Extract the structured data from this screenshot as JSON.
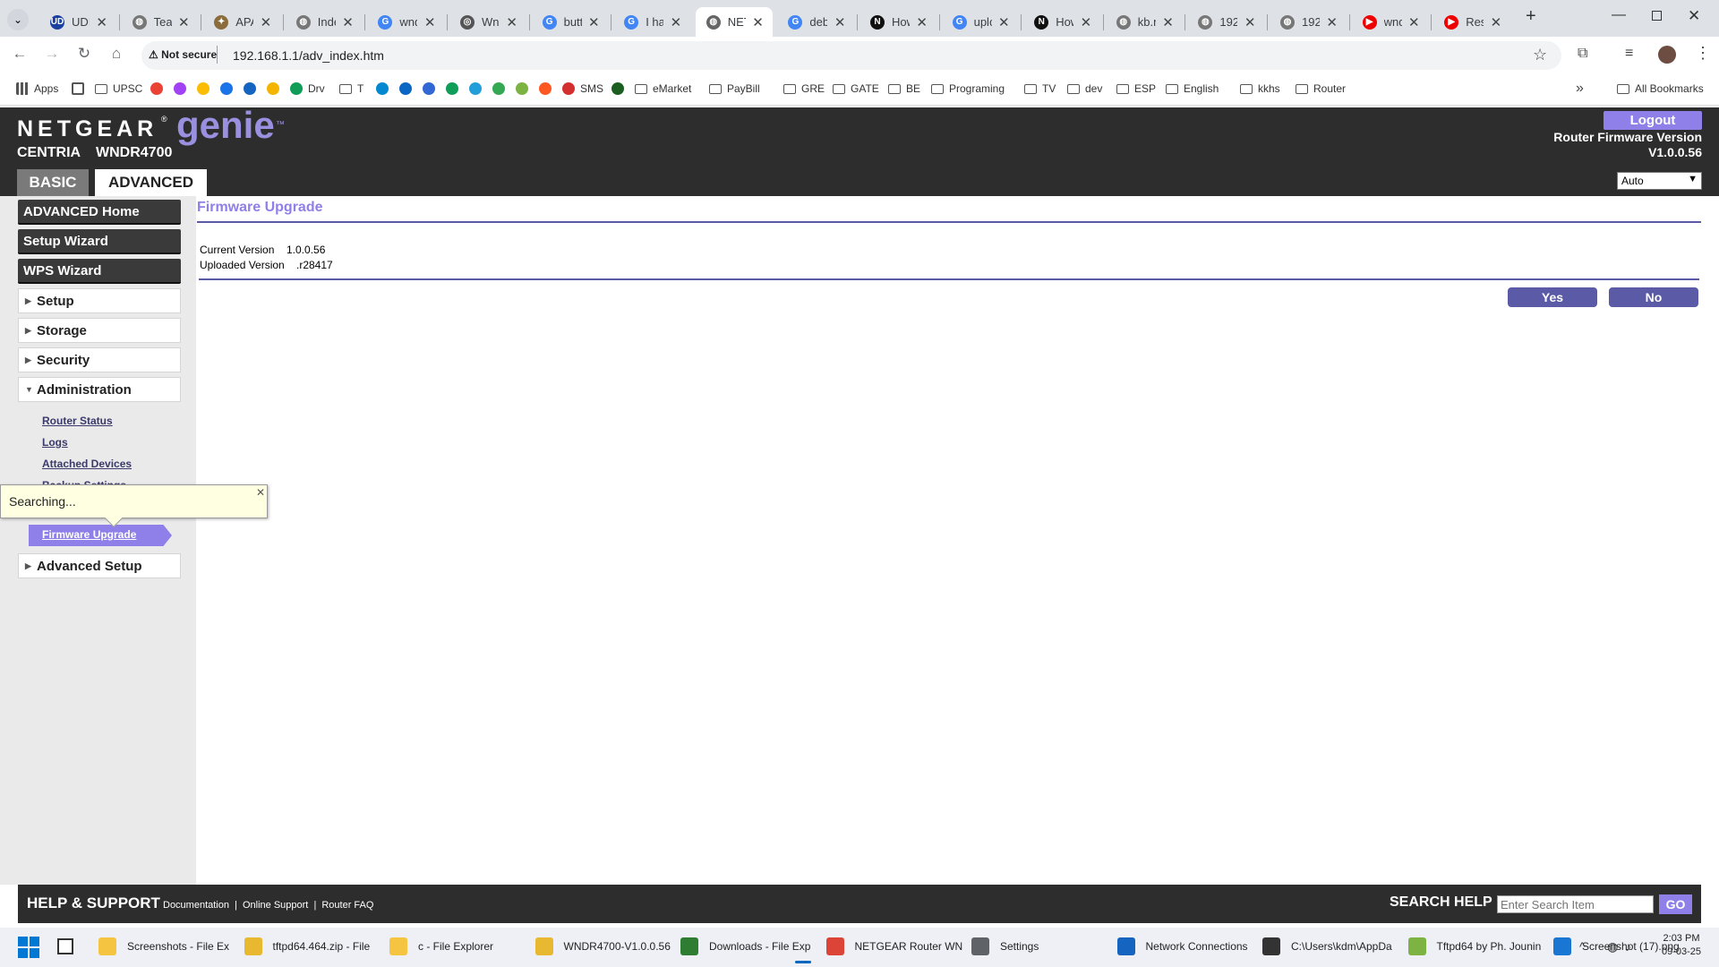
{
  "browser": {
    "tabs": [
      {
        "title": "UDI",
        "fav": "UD",
        "favbg": "#1a3fa0"
      },
      {
        "title": "Teach",
        "fav": "◍",
        "favbg": "#777"
      },
      {
        "title": "APA",
        "fav": "✦",
        "favbg": "#8a6d3b"
      },
      {
        "title": "Index",
        "fav": "◍",
        "favbg": "#777"
      },
      {
        "title": "wndr",
        "fav": "G",
        "favbg": "#4285f4"
      },
      {
        "title": "Wndr",
        "fav": "◎",
        "favbg": "#555"
      },
      {
        "title": "butt",
        "fav": "G",
        "favbg": "#4285f4"
      },
      {
        "title": "I have",
        "fav": "G",
        "favbg": "#4285f4"
      },
      {
        "title": "NETGEAR",
        "fav": "◍",
        "favbg": "#666",
        "active": true
      },
      {
        "title": "debian",
        "fav": "G",
        "favbg": "#4285f4"
      },
      {
        "title": "How",
        "fav": "N",
        "favbg": "#111"
      },
      {
        "title": "upload",
        "fav": "G",
        "favbg": "#4285f4"
      },
      {
        "title": "How",
        "fav": "N",
        "favbg": "#111"
      },
      {
        "title": "kb.net",
        "fav": "◍",
        "favbg": "#777"
      },
      {
        "title": "192",
        "fav": "◍",
        "favbg": "#777"
      },
      {
        "title": "192",
        "fav": "◍",
        "favbg": "#777"
      },
      {
        "title": "wndr",
        "fav": "▶",
        "favbg": "#e00"
      },
      {
        "title": "Reset",
        "fav": "▶",
        "favbg": "#e00"
      }
    ],
    "new_tab": "+",
    "not_secure": "Not secure",
    "url": "192.168.1.1/adv_index.htm",
    "bookmarks": [
      {
        "label": "Apps",
        "kind": "apps"
      },
      {
        "label": "",
        "kind": "grid"
      },
      {
        "label": "UPSC",
        "kind": "folder"
      },
      {
        "label": "",
        "kind": "icon",
        "color": "#ea4335"
      },
      {
        "label": "",
        "kind": "icon",
        "color": "#a142f4"
      },
      {
        "label": "",
        "kind": "icon",
        "color": "#fbbc04"
      },
      {
        "label": "",
        "kind": "icon",
        "color": "#1a73e8"
      },
      {
        "label": "",
        "kind": "icon",
        "color": "#1565c0"
      },
      {
        "label": "",
        "kind": "icon",
        "color": "#f4b400"
      },
      {
        "label": "Drv",
        "kind": "icon",
        "color": "#0f9d58"
      },
      {
        "label": "T",
        "kind": "folder"
      },
      {
        "label": "",
        "kind": "icon",
        "color": "#0288d1"
      },
      {
        "label": "",
        "kind": "icon",
        "color": "#0a66c2"
      },
      {
        "label": "",
        "kind": "icon",
        "color": "#3367d6"
      },
      {
        "label": "",
        "kind": "icon",
        "color": "#0f9d58"
      },
      {
        "label": "",
        "kind": "icon",
        "color": "#229ed9"
      },
      {
        "label": "",
        "kind": "icon",
        "color": "#34a853"
      },
      {
        "label": "",
        "kind": "icon",
        "color": "#7cb342"
      },
      {
        "label": "",
        "kind": "icon",
        "color": "#ff5722"
      },
      {
        "label": "SMS",
        "kind": "icon",
        "color": "#d32f2f"
      },
      {
        "label": "",
        "kind": "icon",
        "color": "#1b5e20"
      },
      {
        "label": "eMarket",
        "kind": "folder"
      },
      {
        "label": "PayBill",
        "kind": "folder"
      },
      {
        "label": "GRE",
        "kind": "folder"
      },
      {
        "label": "GATE",
        "kind": "folder"
      },
      {
        "label": "BE",
        "kind": "folder"
      },
      {
        "label": "Programing",
        "kind": "folder"
      },
      {
        "label": "TV",
        "kind": "folder"
      },
      {
        "label": "dev",
        "kind": "folder"
      },
      {
        "label": "ESP",
        "kind": "folder"
      },
      {
        "label": "English",
        "kind": "folder"
      },
      {
        "label": "kkhs",
        "kind": "folder"
      },
      {
        "label": "Router",
        "kind": "folder"
      }
    ],
    "more_bookmarks": "»",
    "all_bookmarks": "All Bookmarks"
  },
  "router": {
    "brand": "NETGEAR",
    "genie": "genie",
    "tm": "™",
    "series": "CENTRIA",
    "model": "WNDR4700",
    "tab_basic": "BASIC",
    "tab_advanced": "ADVANCED",
    "logout": "Logout",
    "fw_label": "Router Firmware Version",
    "fw_version": "V1.0.0.56",
    "lang": "Auto",
    "nav": {
      "advanced_home": "ADVANCED Home",
      "setup_wizard": "Setup Wizard",
      "wps_wizard": "WPS Wizard",
      "setup": "Setup",
      "storage": "Storage",
      "security": "Security",
      "administration": "Administration",
      "router_status": "Router Status",
      "logs": "Logs",
      "attached_devices": "Attached Devices",
      "backup_settings": "Backup Settings",
      "firmware_upgrade": "Firmware Upgrade",
      "advanced_setup": "Advanced Setup"
    },
    "tooltip_text": "Searching...",
    "page_title": "Firmware Upgrade",
    "current_version_label": "Current Version",
    "current_version": "1.0.0.56",
    "uploaded_version_label": "Uploaded Version",
    "uploaded_version": ".r28417",
    "yes": "Yes",
    "no": "No",
    "footer": {
      "help": "HELP & SUPPORT",
      "doc": "Documentation",
      "online": "Online Support",
      "faq": "Router FAQ",
      "search_label": "SEARCH HELP",
      "search_placeholder": "Enter Search Item",
      "go": "GO"
    }
  },
  "taskbar": {
    "items": [
      {
        "label": "Screenshots - File Ex",
        "color": "#f5c542"
      },
      {
        "label": "tftpd64.464.zip - File",
        "color": "#e8b830"
      },
      {
        "label": "c - File Explorer",
        "color": "#f5c542"
      },
      {
        "label": "WNDR4700-V1.0.0.56",
        "color": "#e8b830"
      },
      {
        "label": "Downloads - File Exp",
        "color": "#2e7d32"
      },
      {
        "label": "NETGEAR Router WN",
        "color": "#db4437"
      },
      {
        "label": "Settings",
        "color": "#5f6368"
      },
      {
        "label": "Network Connections",
        "color": "#1565c0"
      },
      {
        "label": "C:\\Users\\kdm\\AppDa",
        "color": "#333"
      },
      {
        "label": "Tftpd64 by Ph. Jounin",
        "color": "#7cb342"
      },
      {
        "label": "Screenshot (17).png",
        "color": "#1976d2"
      }
    ],
    "time": "2:03 PM",
    "date": "09-03-25"
  }
}
